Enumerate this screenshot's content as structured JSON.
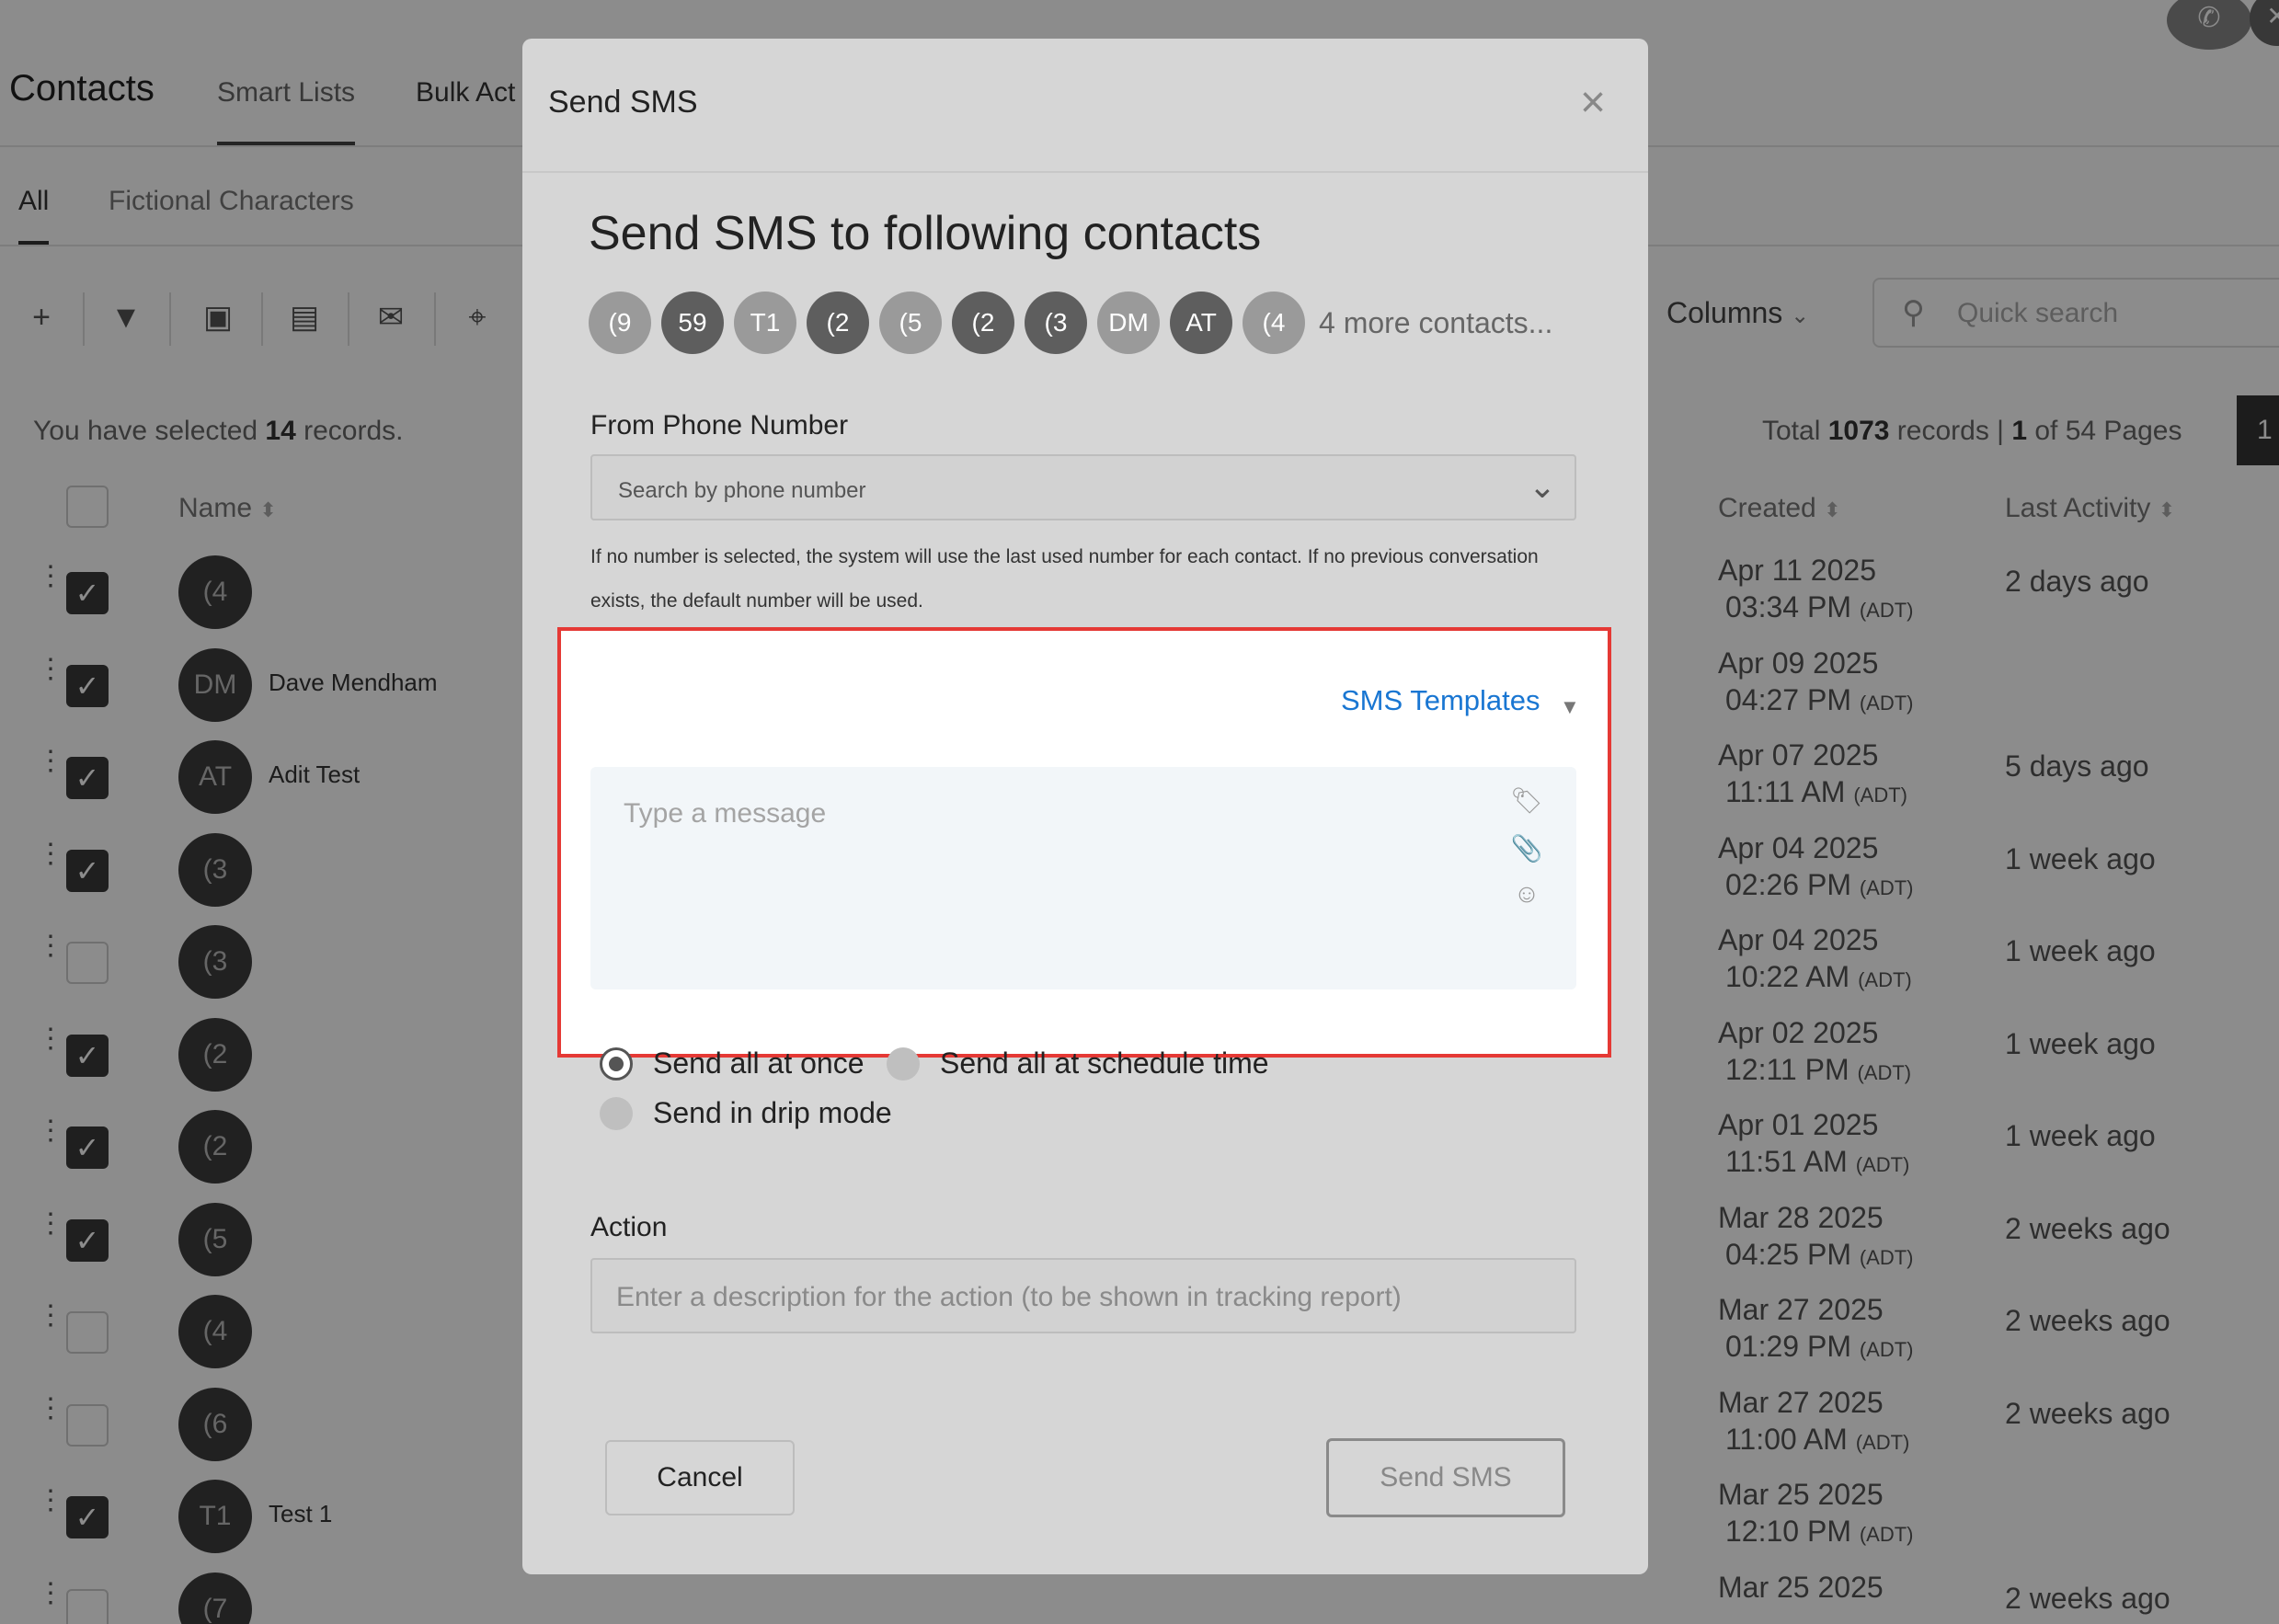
{
  "page": {
    "title": "Contacts",
    "top_tabs": [
      "Smart Lists",
      "Bulk Act"
    ],
    "sub_tabs": [
      "All",
      "Fictional Characters"
    ],
    "columns_label": "Columns",
    "quick_search_placeholder": "Quick search",
    "selection": {
      "prefix": "You have selected ",
      "count": "14",
      "suffix": " records."
    },
    "totals": {
      "prefix": "Total ",
      "records": "1073",
      "mid": " records | ",
      "page": "1",
      "suffix": " of 54 Pages"
    },
    "page_button": "1",
    "headers": {
      "name": "Name",
      "created": "Created",
      "last_activity": "Last Activity"
    },
    "rows": [
      {
        "avatar": "(4",
        "name": "",
        "date": "Apr 11 2025",
        "time": "03:34 PM",
        "tz": "(ADT)",
        "activity": "2 days ago",
        "checked": true
      },
      {
        "avatar": "DM",
        "name": "Dave Mendham",
        "date": "Apr 09 2025",
        "time": "04:27 PM",
        "tz": "(ADT)",
        "activity": "",
        "checked": true
      },
      {
        "avatar": "AT",
        "name": "Adit Test",
        "date": "Apr 07 2025",
        "time": "11:11 AM",
        "tz": "(ADT)",
        "activity": "5 days ago",
        "checked": true
      },
      {
        "avatar": "(3",
        "name": "",
        "date": "Apr 04 2025",
        "time": "02:26 PM",
        "tz": "(ADT)",
        "activity": "1 week ago",
        "checked": true
      },
      {
        "avatar": "(3",
        "name": "",
        "date": "Apr 04 2025",
        "time": "10:22 AM",
        "tz": "(ADT)",
        "activity": "1 week ago",
        "checked": false
      },
      {
        "avatar": "(2",
        "name": "",
        "date": "Apr 02 2025",
        "time": "12:11 PM",
        "tz": "(ADT)",
        "activity": "1 week ago",
        "checked": true
      },
      {
        "avatar": "(2",
        "name": "",
        "date": "Apr 01 2025",
        "time": "11:51 AM",
        "tz": "(ADT)",
        "activity": "1 week ago",
        "checked": true
      },
      {
        "avatar": "(5",
        "name": "",
        "date": "Mar 28 2025",
        "time": "04:25 PM",
        "tz": "(ADT)",
        "activity": "2 weeks ago",
        "checked": true
      },
      {
        "avatar": "(4",
        "name": "",
        "date": "Mar 27 2025",
        "time": "01:29 PM",
        "tz": "(ADT)",
        "activity": "2 weeks ago",
        "checked": false
      },
      {
        "avatar": "(6",
        "name": "",
        "date": "Mar 27 2025",
        "time": "11:00 AM",
        "tz": "(ADT)",
        "activity": "2 weeks ago",
        "checked": false
      },
      {
        "avatar": "T1",
        "name": "Test 1",
        "date": "Mar 25 2025",
        "time": "12:10 PM",
        "tz": "(ADT)",
        "activity": "",
        "checked": true
      },
      {
        "avatar": "(7",
        "name": "",
        "date": "Mar 25 2025",
        "time": "",
        "tz": "",
        "activity": "2 weeks ago",
        "checked": false
      }
    ]
  },
  "modal": {
    "title": "Send SMS",
    "close_label": "×",
    "heading": "Send SMS to following contacts",
    "chips": [
      {
        "label": "(9",
        "tone": "light"
      },
      {
        "label": "59",
        "tone": "dark"
      },
      {
        "label": "T1",
        "tone": "light"
      },
      {
        "label": "(2",
        "tone": "dark"
      },
      {
        "label": "(5",
        "tone": "light"
      },
      {
        "label": "(2",
        "tone": "dark"
      },
      {
        "label": "(3",
        "tone": "dark"
      },
      {
        "label": "DM",
        "tone": "light"
      },
      {
        "label": "AT",
        "tone": "dark"
      },
      {
        "label": "(4",
        "tone": "light"
      }
    ],
    "more_contacts": "4 more contacts...",
    "from_label": "From Phone Number",
    "phone_placeholder": "Search by phone number",
    "hint": "If no number is selected, the system will use the last used number for each contact. If no previous conversation exists, the default number will be used.",
    "templates_label": "SMS Templates",
    "message_placeholder": "Type a message",
    "send_options": {
      "all_at_once": "Send all at once",
      "schedule": "Send all at schedule time",
      "drip": "Send in drip mode"
    },
    "action_label": "Action",
    "action_placeholder": "Enter a description for the action (to be shown in tracking report)",
    "cancel_label": "Cancel",
    "send_label": "Send SMS",
    "icons": {
      "tag": "tag-icon",
      "attach": "paperclip-icon",
      "emoji": "emoji-icon"
    },
    "highlight_color": "#e53935",
    "accent_color": "#1976d2"
  }
}
